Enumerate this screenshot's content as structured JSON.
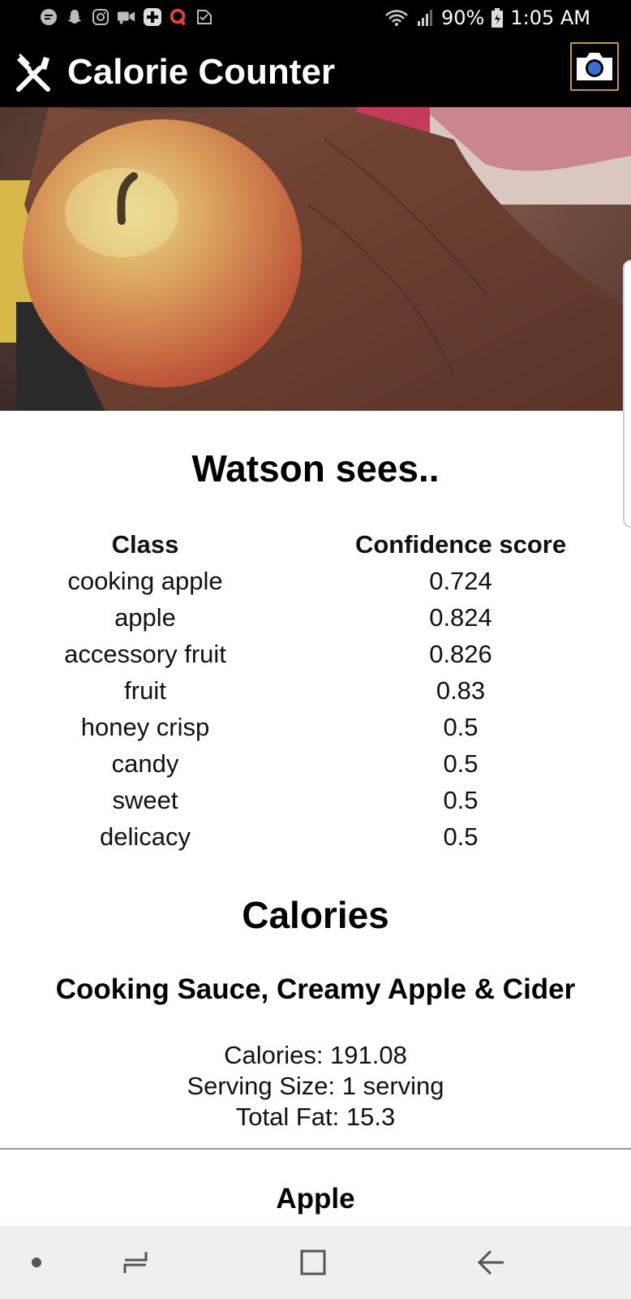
{
  "status_bar": {
    "battery": "90%",
    "time": "1:05 AM",
    "left_icons": [
      "message-icon",
      "snapchat-icon",
      "instagram-icon",
      "video-chat-icon",
      "plus-app-icon",
      "quora-icon",
      "check-app-icon"
    ],
    "right_icons": [
      "wifi-icon",
      "signal-icon",
      "battery-icon"
    ]
  },
  "app_bar": {
    "title": "Calorie Counter",
    "logo_icon": "utensils-icon",
    "camera_icon": "camera-icon",
    "camera_accent": "#c8962e"
  },
  "photo": {
    "subject": "apple in hand"
  },
  "watson": {
    "heading": "Watson sees..",
    "columns": [
      "Class",
      "Confidence score"
    ],
    "rows": [
      {
        "class": "cooking apple",
        "score": "0.724"
      },
      {
        "class": "apple",
        "score": "0.824"
      },
      {
        "class": "accessory fruit",
        "score": "0.826"
      },
      {
        "class": "fruit",
        "score": "0.83"
      },
      {
        "class": "honey crisp",
        "score": "0.5"
      },
      {
        "class": "candy",
        "score": "0.5"
      },
      {
        "class": "sweet",
        "score": "0.5"
      },
      {
        "class": "delicacy",
        "score": "0.5"
      }
    ]
  },
  "calories": {
    "heading": "Calories",
    "items": [
      {
        "name": "Cooking Sauce, Creamy Apple & Cider",
        "calories": "Calories: 191.08",
        "serving": "Serving Size: 1 serving",
        "fat": "Total Fat: 15.3"
      },
      {
        "name": "Apple"
      }
    ]
  },
  "nav_bar": {
    "items": [
      "dot-icon",
      "recents-icon",
      "home-icon",
      "back-icon"
    ]
  }
}
